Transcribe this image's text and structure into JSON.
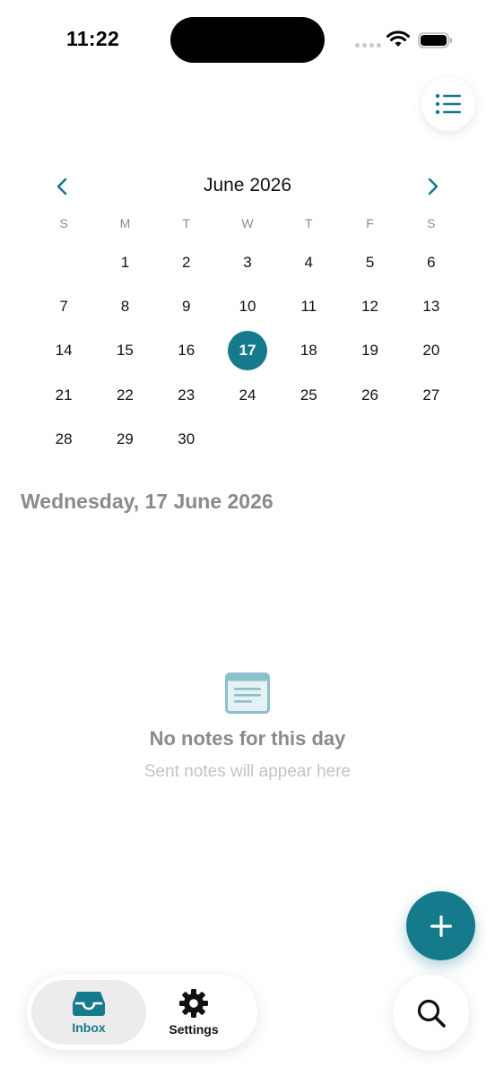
{
  "status_bar": {
    "time": "11:22"
  },
  "calendar": {
    "month_title": "June 2026",
    "weekdays": [
      "S",
      "M",
      "T",
      "W",
      "T",
      "F",
      "S"
    ],
    "leading_blank_days": 1,
    "days": [
      "1",
      "2",
      "3",
      "4",
      "5",
      "6",
      "7",
      "8",
      "9",
      "10",
      "11",
      "12",
      "13",
      "14",
      "15",
      "16",
      "17",
      "18",
      "19",
      "20",
      "21",
      "22",
      "23",
      "24",
      "25",
      "26",
      "27",
      "28",
      "29",
      "30"
    ],
    "selected_day": "17"
  },
  "selected_date_label": "Wednesday, 17 June 2026",
  "empty_state": {
    "title": "No notes for this day",
    "subtitle": "Sent notes will appear here"
  },
  "tabs": [
    {
      "label": "Inbox",
      "icon": "inbox-tray-icon",
      "active": true
    },
    {
      "label": "Settings",
      "icon": "gear-icon",
      "active": false
    }
  ],
  "icons": {
    "top_right": "list-icon",
    "nav_prev": "chevron-left-icon",
    "nav_next": "chevron-right-icon",
    "fab": "plus-icon",
    "search": "search-icon",
    "empty": "note-card-icon"
  },
  "colors": {
    "accent": "#157a8c",
    "muted_text": "#8a8a8a",
    "faint_text": "#c3c3c3",
    "active_tab_bg": "#ececec"
  }
}
